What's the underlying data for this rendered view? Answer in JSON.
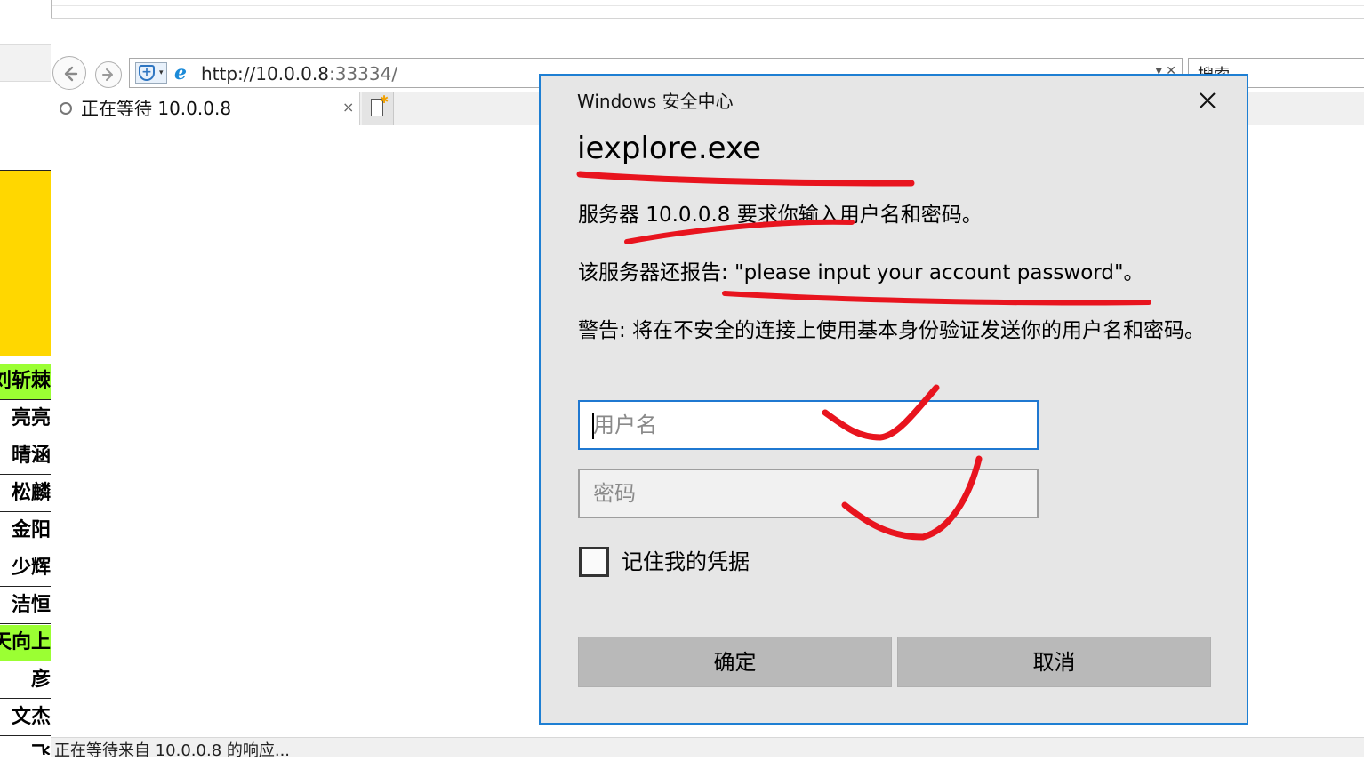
{
  "spreadsheet": {
    "names": [
      {
        "text": "刘斩棘",
        "green": true
      },
      {
        "text": "亮亮",
        "green": false
      },
      {
        "text": "晴涵",
        "green": false
      },
      {
        "text": "松麟",
        "green": false
      },
      {
        "text": "金阳",
        "green": false
      },
      {
        "text": "少辉",
        "green": false
      },
      {
        "text": "洁恒",
        "green": false
      },
      {
        "text": "天向上",
        "green": true
      },
      {
        "text": "彦",
        "green": false
      },
      {
        "text": "文杰",
        "green": false
      },
      {
        "text": "飞",
        "green": false
      }
    ]
  },
  "browser": {
    "url_host": "http://10.0.0.8",
    "url_rest": ":33334/",
    "search_placeholder": "搜索",
    "tab_title": "正在等待 10.0.0.8",
    "tab_close": "×",
    "status_text": "正在等待来自 10.0.0.8 的响应..."
  },
  "dialog": {
    "caption": "Windows 安全中心",
    "app_name": "iexplore.exe",
    "message_1": "服务器 10.0.0.8 要求你输入用户名和密码。",
    "message_2": "该服务器还报告: \"please input your account password\"。",
    "warning": "警告: 将在不安全的连接上使用基本身份验证发送你的用户名和密码。",
    "username_placeholder": "用户名",
    "password_placeholder": "密码",
    "remember_label": "记住我的凭据",
    "ok_label": "确定",
    "cancel_label": "取消"
  },
  "colors": {
    "dialog_border": "#1e7fd3",
    "annotation_red": "#e8141e",
    "spreadsheet_yellow": "#ffd700",
    "spreadsheet_green": "#9bff33"
  },
  "icons": [
    "back-arrow-icon",
    "forward-arrow-icon",
    "security-shield-icon",
    "ie-logo-icon",
    "loading-spinner-icon",
    "new-tab-icon",
    "close-icon"
  ]
}
